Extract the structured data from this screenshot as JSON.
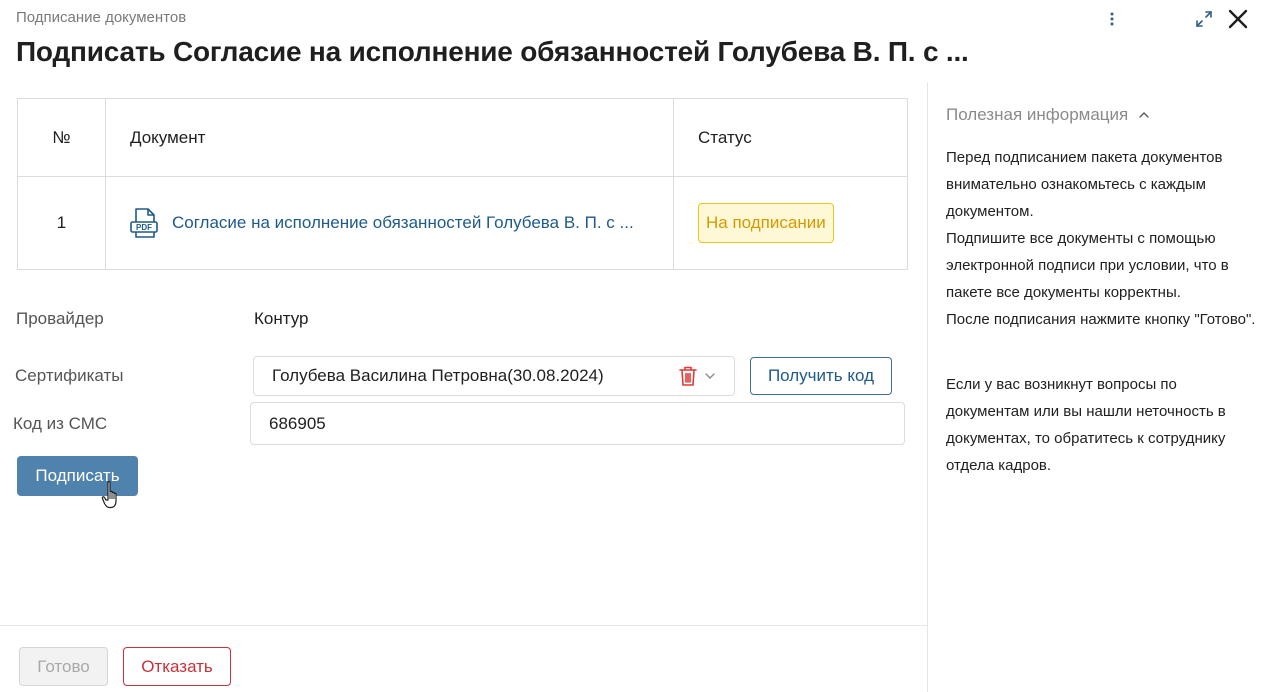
{
  "header": {
    "breadcrumb": "Подписание документов",
    "title": "Подписать Согласие на исполнение обязанностей Голубева В. П. с ..."
  },
  "table": {
    "columns": [
      "№",
      "Документ",
      "Статус"
    ],
    "rows": [
      {
        "num": "1",
        "document": "Согласие на исполнение обязанностей Голубева В. П. с ...",
        "status": "На подписании"
      }
    ]
  },
  "form": {
    "provider_label": "Провайдер",
    "provider_value": "Контур",
    "certs_label": "Сертификаты",
    "cert_value": "Голубева Василина Петровна(30.08.2024)",
    "get_code_label": "Получить код",
    "sms_label": "Код из СМС",
    "sms_value": "686905",
    "sign_label": "Подписать"
  },
  "footer": {
    "done_label": "Готово",
    "reject_label": "Отказать"
  },
  "sidebar": {
    "title": "Полезная информация",
    "paragraph1": "Перед подписанием пакета документов внимательно ознакомьтесь с каждым документом.\nПодпишите все документы с помощью электронной подписи при условии, что в пакете все документы корректны.\nПосле подписания нажмите кнопку \"Готово\".",
    "paragraph2": "Если у вас возникнут вопросы по документам или вы нашли неточность в документах, то обратитесь к сотруднику отдела кадров."
  },
  "icons": {
    "more": "more-vertical-icon",
    "expand": "expand-icon",
    "close": "close-icon",
    "pdf": "pdf-file-icon",
    "trash": "trash-icon",
    "chevron": "chevron-down-icon",
    "cursor": "hand-cursor-icon"
  },
  "colors": {
    "link": "#1e5a8c",
    "primary_button": "#4f83ad",
    "status_bg": "#fff8d6",
    "status_border": "#f2c417",
    "status_text": "#d49a00",
    "danger": "#c8323a",
    "trash": "#e03a3a"
  }
}
